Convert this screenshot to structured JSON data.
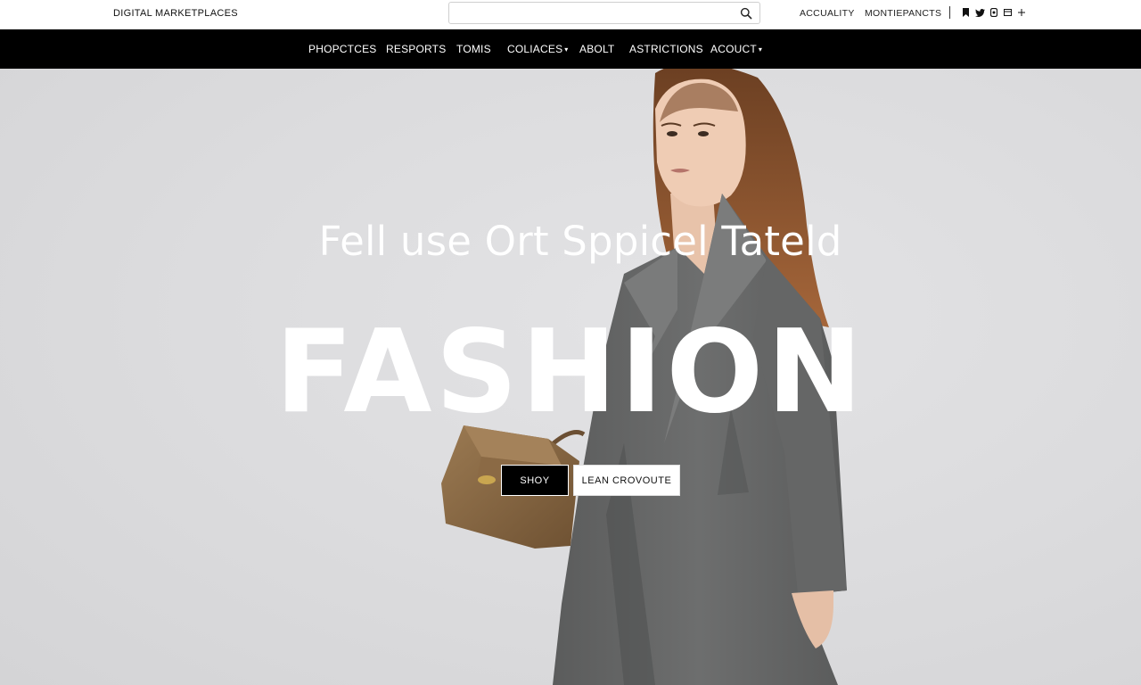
{
  "header": {
    "brand": "DIGITAL MARKETPLACES",
    "search_value": "",
    "search_placeholder": "",
    "links": [
      "ACCUALITY",
      "MONTIEPANCTS"
    ],
    "social_icons": [
      "bookmark-icon",
      "twitter-icon",
      "instagram-icon",
      "mail-icon",
      "plus-icon"
    ]
  },
  "nav": {
    "items": [
      {
        "label": "PHOPCTCES"
      },
      {
        "label": "RESPORTS"
      },
      {
        "label": "TOMIS"
      },
      {
        "label": "COLIACES",
        "caret": "▾"
      },
      {
        "label": "ABOLT"
      },
      {
        "label": "ASTRICTIONS"
      },
      {
        "label": "ACOUCT",
        "caret": "▾"
      }
    ]
  },
  "hero": {
    "tagline": "Fell use Ort Sppicel Tateld",
    "headline": "FASHION",
    "primary_button": "SHOY",
    "secondary_button": "LEAN CROVOUTE",
    "colors": {
      "background": "#dcdcde",
      "nav": "#000000",
      "coat": "#6a6b6b",
      "bag": "#8a6a44"
    }
  }
}
